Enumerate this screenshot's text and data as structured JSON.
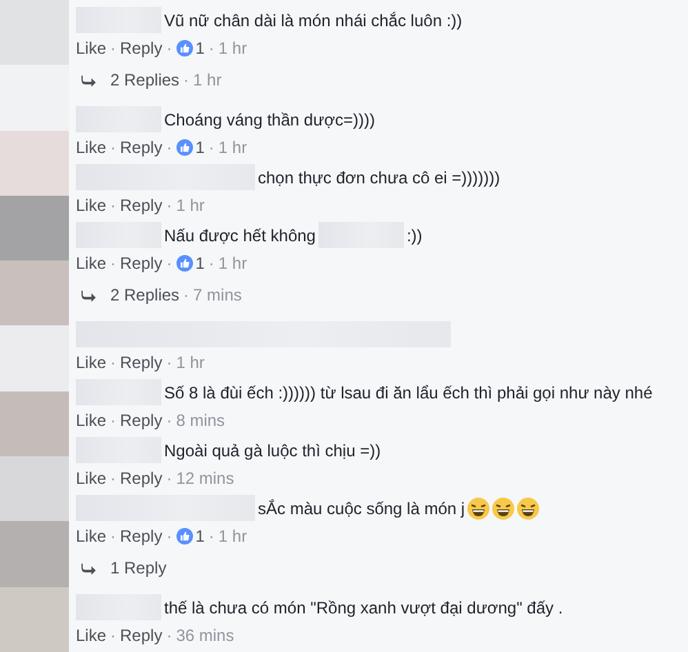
{
  "separator": "·",
  "comments": [
    {
      "parts": [
        {
          "kind": "blur-short"
        },
        {
          "kind": "text",
          "text": "Vũ nữ chân dài là món nhái chắc luôn :))"
        }
      ],
      "actions": [
        "Like",
        "Reply"
      ],
      "likes": "1",
      "time": "1 hr",
      "replies": {
        "label": "2 Replies",
        "time": "1 hr"
      }
    },
    {
      "parts": [
        {
          "kind": "blur-short"
        },
        {
          "kind": "text",
          "text": "Choáng váng thần dược=))))"
        }
      ],
      "actions": [
        "Like",
        "Reply"
      ],
      "likes": "1",
      "time": "1 hr"
    },
    {
      "parts": [
        {
          "kind": "blur-long"
        },
        {
          "kind": "text",
          "text": "chọn thực đơn chưa cô ei =)))))))"
        }
      ],
      "actions": [
        "Like",
        "Reply"
      ],
      "time": "1 hr"
    },
    {
      "parts": [
        {
          "kind": "blur-short"
        },
        {
          "kind": "text",
          "text": "Nấu được hết không"
        },
        {
          "kind": "blur-short"
        },
        {
          "kind": "text",
          "text": ":))"
        }
      ],
      "actions": [
        "Like",
        "Reply"
      ],
      "likes": "1",
      "time": "1 hr",
      "replies": {
        "label": "2 Replies",
        "time": "7 mins"
      }
    },
    {
      "parts": [
        {
          "kind": "blur-wide"
        }
      ],
      "actions": [
        "Like",
        "Reply"
      ],
      "time": "1 hr"
    },
    {
      "parts": [
        {
          "kind": "blur-short"
        },
        {
          "kind": "text",
          "text": "Số 8 là đùi ếch :)))))) từ lsau đi ăn lẩu ếch thì phải gọi như này nhé"
        }
      ],
      "actions": [
        "Like",
        "Reply"
      ],
      "time": "8 mins"
    },
    {
      "parts": [
        {
          "kind": "blur-short"
        },
        {
          "kind": "text",
          "text": "Ngoài quả gà luộc thì chịu =))"
        }
      ],
      "actions": [
        "Like",
        "Reply"
      ],
      "time": "12 mins"
    },
    {
      "parts": [
        {
          "kind": "blur-long"
        },
        {
          "kind": "text",
          "text": "sẮc màu cuộc sống là món j"
        },
        {
          "kind": "emoji"
        },
        {
          "kind": "emoji"
        },
        {
          "kind": "emoji"
        }
      ],
      "actions": [
        "Like",
        "Reply"
      ],
      "likes": "1",
      "time": "1 hr",
      "replies": {
        "label": "1 Reply"
      }
    },
    {
      "parts": [
        {
          "kind": "blur-short"
        },
        {
          "kind": "text",
          "text": "thế là chưa có món \"Rồng xanh vượt đại dương\" đấy ."
        }
      ],
      "actions": [
        "Like",
        "Reply"
      ],
      "time": "36 mins"
    }
  ]
}
